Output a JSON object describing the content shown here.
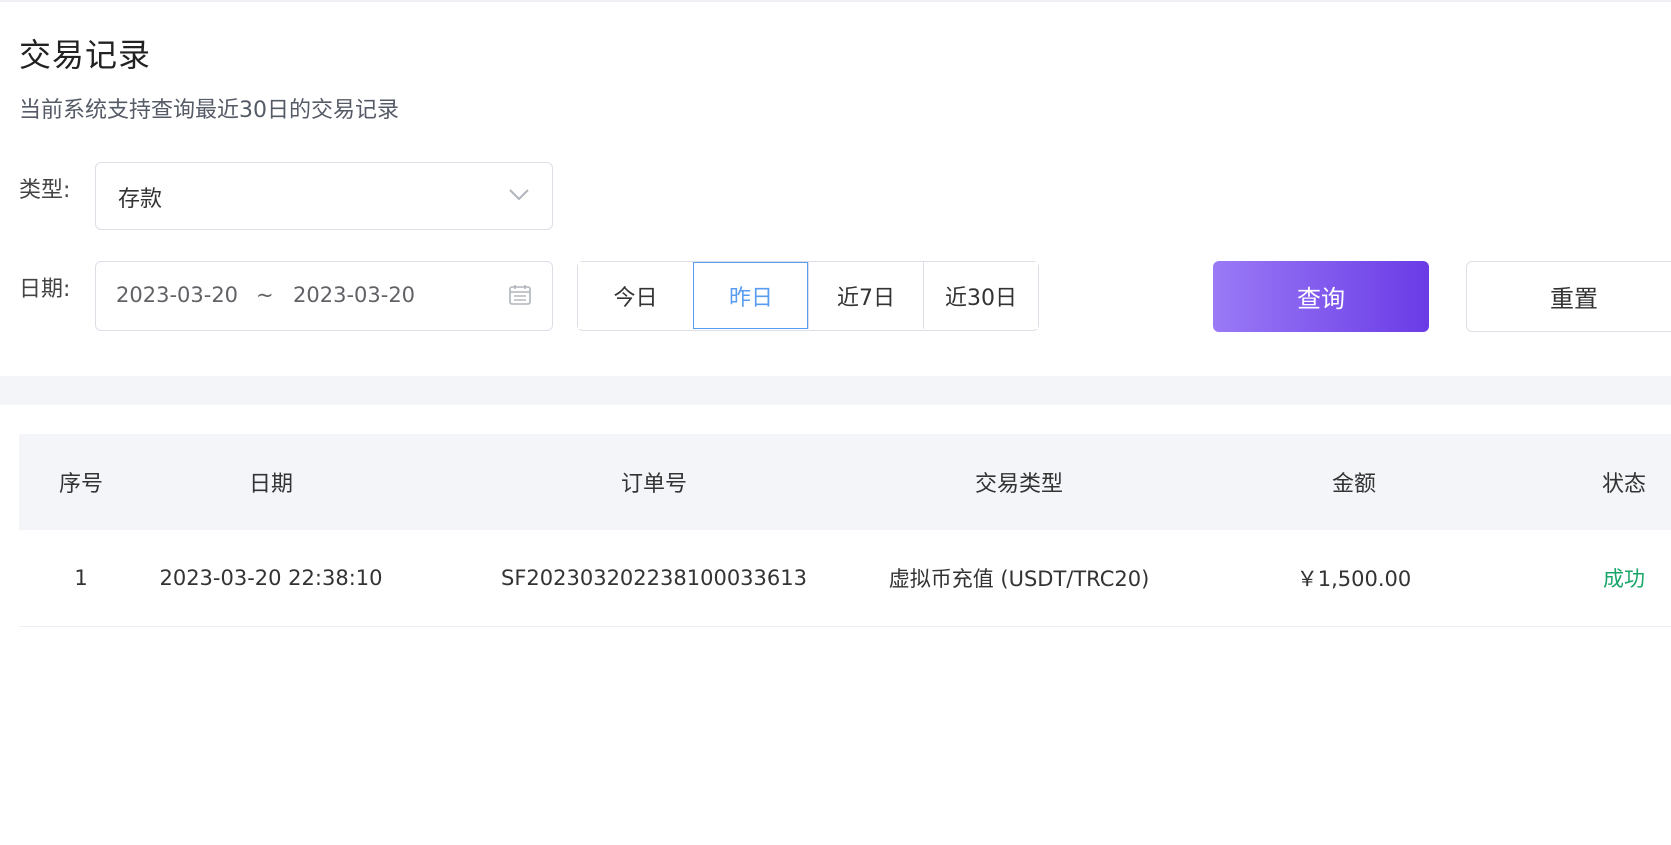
{
  "page": {
    "title": "交易记录",
    "subtitle": "当前系统支持查询最近30日的交易记录"
  },
  "filters": {
    "type_label": "类型:",
    "type_value": "存款",
    "date_label": "日期:",
    "date_start": "2023-03-20",
    "date_separator": "~",
    "date_end": "2023-03-20",
    "quick_ranges": [
      {
        "label": "今日",
        "active": false
      },
      {
        "label": "昨日",
        "active": true
      },
      {
        "label": "近7日",
        "active": false
      },
      {
        "label": "近30日",
        "active": false
      }
    ],
    "query_label": "查询",
    "reset_label": "重置"
  },
  "table": {
    "headers": [
      "序号",
      "日期",
      "订单号",
      "交易类型",
      "金额",
      "状态"
    ],
    "rows": [
      [
        "1",
        "2023-03-20 22:38:10",
        "SF2023032022381000336​13",
        "虚拟币充值 (USDT/TRC20)",
        "￥1,500.00",
        "成功"
      ]
    ]
  },
  "colors": {
    "accent_start": "#9a7af6",
    "accent_end": "#6a3be6",
    "active_blue": "#5a9df0",
    "success_green": "#1aa66a"
  },
  "icons": {
    "select": "chevron-down-icon",
    "date": "calendar-icon"
  }
}
